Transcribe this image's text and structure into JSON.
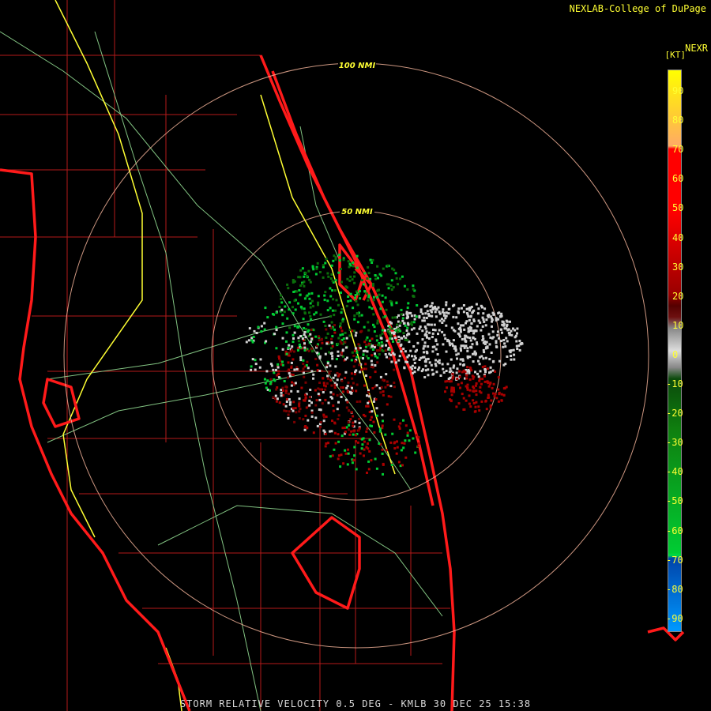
{
  "credit": "NEXLAB-College of DuPage",
  "caption": "STORM RELATIVE VELOCITY 0.5 DEG - KMLB 30 DEC 25 15:38",
  "rings": [
    {
      "label": "100 NMI"
    },
    {
      "label": "50 NMI"
    }
  ],
  "legend": {
    "title": "NEXR",
    "unit": "[KT]",
    "ticks": [
      "90",
      "80",
      "70",
      "60",
      "50",
      "40",
      "30",
      "20",
      "10",
      "0",
      "-10",
      "-20",
      "-30",
      "-40",
      "-50",
      "-60",
      "-70",
      "-80",
      "-90"
    ],
    "colors": {
      "inbound_strong": "#0099ff",
      "inbound": "#00cc33",
      "neutral": "#d0d0d0",
      "outbound": "#aa0000",
      "outbound_strong": "#ff0000",
      "outbound_extreme": "#ffdd00"
    }
  },
  "map_colors": {
    "coastline": "#ff1a1a",
    "county": "#b31a1a",
    "highway": "#ffff33",
    "roads": "#99e699",
    "range_ring": "#ffbba0"
  }
}
